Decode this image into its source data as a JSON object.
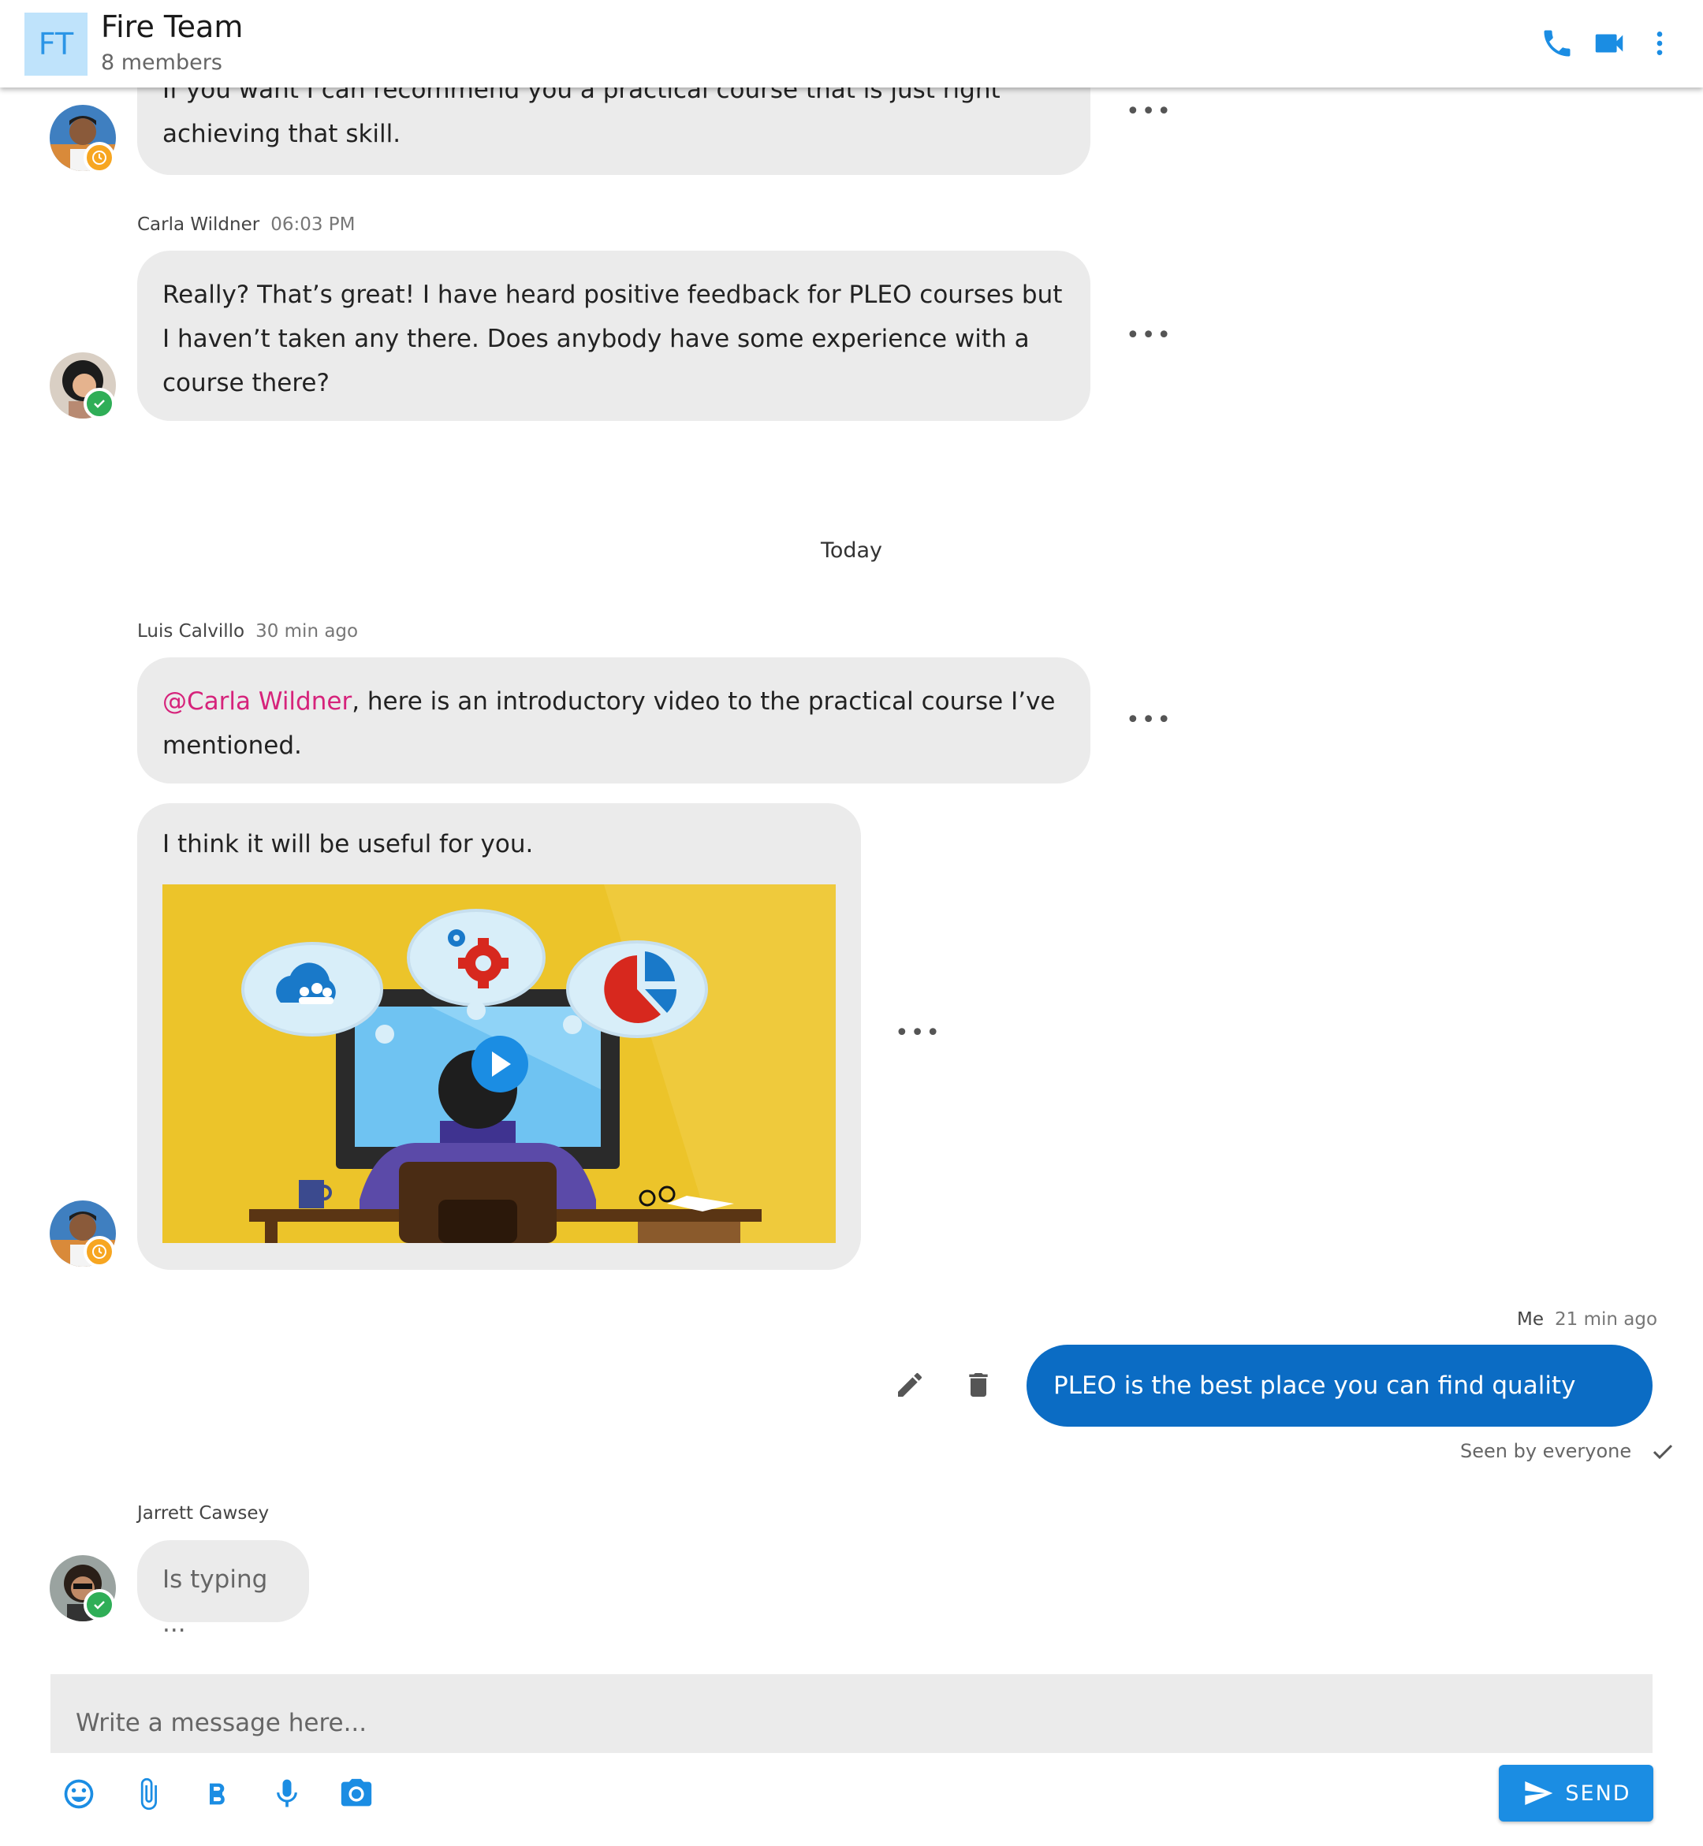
{
  "header": {
    "avatar_initials": "FT",
    "title": "Fire Team",
    "members": "8 members",
    "icons": [
      "phone-icon",
      "video-camera-icon",
      "more-vertical-icon"
    ]
  },
  "messages": [
    {
      "text": "If you want I can recommend you a practical course that is just right achieving that skill.",
      "status": "away"
    },
    {
      "author": "Carla Wildner",
      "time": "06:03 PM",
      "text": "Really? That’s great! I have heard positive feedback for PLEO courses but I haven’t taken any there. Does anybody have some experience with a course there?",
      "status": "online"
    }
  ],
  "day_separator": "Today",
  "luis": {
    "author": "Luis Calvillo",
    "time": "30 min ago",
    "mention": "@Carla Wildner",
    "text_after_mention": ", here is an introductory video to the practical course I’ve mentioned.",
    "second_text": "I think it will be useful for you.",
    "status": "away"
  },
  "me": {
    "author": "Me",
    "time": "21 min ago",
    "text": "PLEO is the best place you can find quality courses!",
    "seen": "Seen by everyone"
  },
  "jarrett": {
    "author": "Jarrett Cawsey",
    "typing": "Is typing ...",
    "status": "online"
  },
  "more_label": "•••",
  "composer": {
    "placeholder": "Write a message here...",
    "send_label": "SEND",
    "tools": [
      "emoji-icon",
      "attach-icon",
      "bold-icon",
      "microphone-icon",
      "camera-icon"
    ]
  },
  "colors": {
    "accent": "#1b8de3",
    "own_bubble": "#0b6cc4",
    "mention": "#d6237b",
    "away": "#f7a621",
    "online": "#2fae57"
  }
}
